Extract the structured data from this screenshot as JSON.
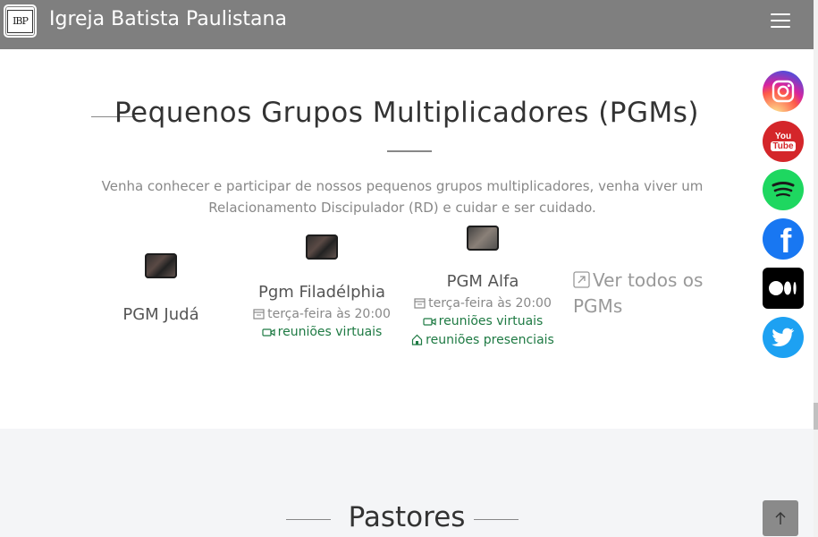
{
  "header": {
    "logo_text": "IBP",
    "title": "Igreja Batista Paulistana",
    "menu_icon": "hamburger-icon"
  },
  "section": {
    "title": "Pequenos Grupos Multiplicadores (PGMs)",
    "subtitle": "Venha conhecer e participar de nossos pequenos grupos multiplicadores, venha viver um Relacionamento Discipulador (RD) e cuidar e ser cuidado."
  },
  "pgms": [
    {
      "name": "PGM Judá"
    },
    {
      "name": "Pgm Filadélphia",
      "schedule": "terça-feira às 20:00",
      "mode_virtual": "reuniões virtuais"
    },
    {
      "name": "PGM Alfa",
      "schedule": "terça-feira às 20:00",
      "mode_virtual": "reuniões virtuais",
      "mode_presencial": "reuniões presenciais"
    }
  ],
  "see_all": {
    "label": "Ver todos os PGMs",
    "icon": "external-arrow-icon"
  },
  "social": [
    {
      "name": "instagram",
      "icon": "instagram-icon"
    },
    {
      "name": "youtube",
      "icon": "youtube-icon",
      "text": "You Tube"
    },
    {
      "name": "spotify",
      "icon": "spotify-icon"
    },
    {
      "name": "facebook",
      "icon": "facebook-icon"
    },
    {
      "name": "medium",
      "icon": "medium-icon"
    },
    {
      "name": "twitter",
      "icon": "twitter-icon"
    }
  ],
  "pastores": {
    "title": "Pastores"
  },
  "back_to_top": {
    "icon": "arrow-up-icon"
  },
  "colors": {
    "header_bg": "#7f7f7f",
    "green": "#1e7a43",
    "lower_bg": "#f4f5f7"
  }
}
